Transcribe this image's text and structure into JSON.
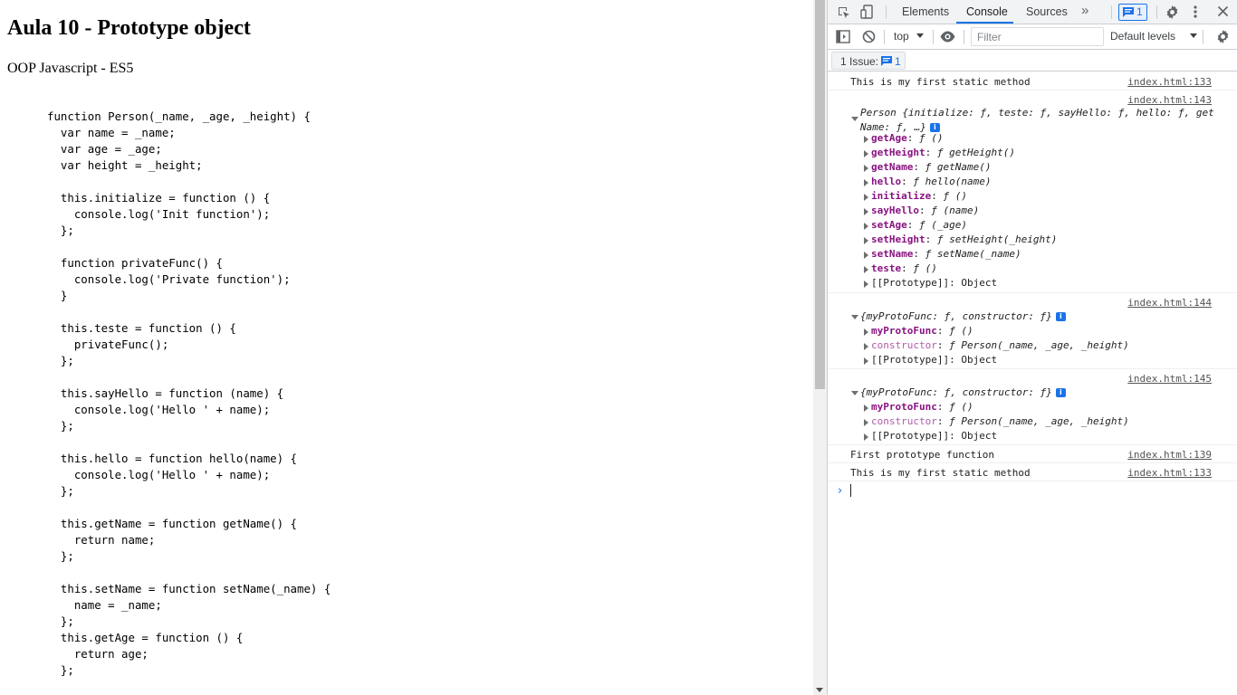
{
  "page": {
    "title": "Aula 10 - Prototype object",
    "subtitle": "OOP Javascript - ES5",
    "code_lines": [
      "function Person(_name, _age, _height) {",
      "  var name = _name;",
      "  var age = _age;",
      "  var height = _height;",
      "",
      "  this.initialize = function () {",
      "    console.log('Init function');",
      "  };",
      "",
      "  function privateFunc() {",
      "    console.log('Private function');",
      "  }",
      "",
      "  this.teste = function () {",
      "    privateFunc();",
      "  };",
      "",
      "  this.sayHello = function (name) {",
      "    console.log('Hello ' + name);",
      "  };",
      "",
      "  this.hello = function hello(name) {",
      "    console.log('Hello ' + name);",
      "  };",
      "",
      "  this.getName = function getName() {",
      "    return name;",
      "  };",
      "",
      "  this.setName = function setName(_name) {",
      "    name = _name;",
      "  };",
      "  this.getAge = function () {",
      "    return age;",
      "  };"
    ]
  },
  "devtools": {
    "tabs": [
      "Elements",
      "Console",
      "Sources"
    ],
    "active_tab": "Console",
    "more_tabs_glyph": "»",
    "message_badge_count": "1",
    "context": "top",
    "filter_placeholder": "Filter",
    "levels": "Default levels",
    "issues_label": "1 Issue:",
    "issues_count": "1",
    "accent_color": "#1a73e8"
  },
  "console": {
    "msg1": {
      "text": "This is my first static method",
      "source": "index.html:133"
    },
    "person": {
      "source": "index.html:143",
      "preview_line1": "Person {initialize: ƒ, teste: ƒ, sayHello: ƒ, hello: ƒ, get",
      "preview_line2": "Name: ƒ, …}",
      "props": [
        {
          "key": "getAge",
          "value": "ƒ ()"
        },
        {
          "key": "getHeight",
          "value": "ƒ getHeight()"
        },
        {
          "key": "getName",
          "value": "ƒ getName()"
        },
        {
          "key": "hello",
          "value": "ƒ hello(name)"
        },
        {
          "key": "initialize",
          "value": "ƒ ()"
        },
        {
          "key": "sayHello",
          "value": "ƒ (name)"
        },
        {
          "key": "setAge",
          "value": "ƒ (_age)"
        },
        {
          "key": "setHeight",
          "value": "ƒ setHeight(_height)"
        },
        {
          "key": "setName",
          "value": "ƒ setName(_name)"
        },
        {
          "key": "teste",
          "value": "ƒ ()"
        }
      ],
      "prototype_label": "[[Prototype]]: Object"
    },
    "proto1": {
      "source": "index.html:144",
      "preview": "{myProtoFunc: ƒ, constructor: ƒ}",
      "prop1_key": "myProtoFunc",
      "prop1_value": "ƒ ()",
      "prop2_key": "constructor",
      "prop2_value": "ƒ Person(_name, _age, _height)",
      "prototype_label": "[[Prototype]]: Object"
    },
    "proto2": {
      "source": "index.html:145",
      "preview": "{myProtoFunc: ƒ, constructor: ƒ}",
      "prop1_key": "myProtoFunc",
      "prop1_value": "ƒ ()",
      "prop2_key": "constructor",
      "prop2_value": "ƒ Person(_name, _age, _height)",
      "prototype_label": "[[Prototype]]: Object"
    },
    "msg2": {
      "text": "First prototype function",
      "source": "index.html:139"
    },
    "msg3": {
      "text": "This is my first static method",
      "source": "index.html:133"
    },
    "prompt": "›"
  }
}
